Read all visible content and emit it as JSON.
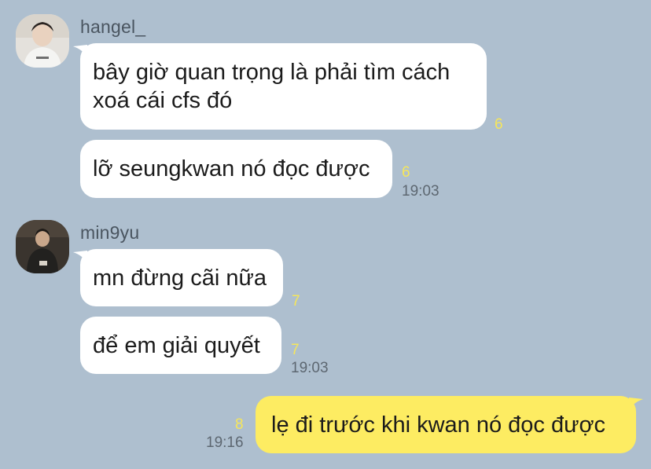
{
  "messages": [
    {
      "sender": "hangel_",
      "bubbles": [
        {
          "text": "bây giờ quan trọng là phải tìm cách xoá cái cfs đó",
          "unread": "6"
        },
        {
          "text": "lỡ seungkwan nó đọc được",
          "unread": "6",
          "time": "19:03"
        }
      ]
    },
    {
      "sender": "min9yu",
      "bubbles": [
        {
          "text": "mn đừng cãi nữa",
          "unread": "7"
        },
        {
          "text": "để em giải quyết",
          "unread": "7",
          "time": "19:03"
        }
      ]
    },
    {
      "sender": "me",
      "bubbles": [
        {
          "text": "lẹ đi trước khi kwan nó đọc được",
          "unread": "8",
          "time": "19:16"
        }
      ]
    }
  ],
  "colors": {
    "background": "#aebfcf",
    "incoming_bubble": "#ffffff",
    "outgoing_bubble": "#fdec62",
    "unread_count": "#f6e65a"
  }
}
